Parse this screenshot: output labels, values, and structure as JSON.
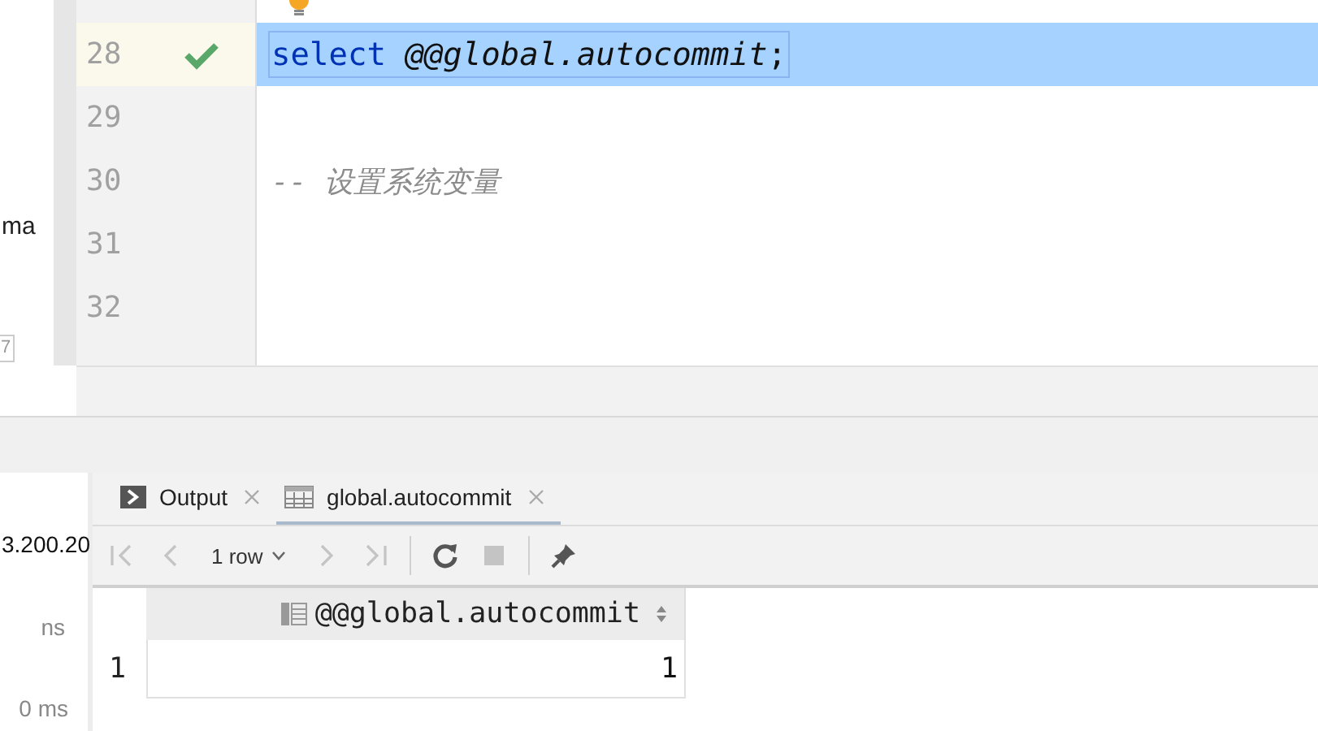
{
  "sidebar": {
    "top_texts": [
      "ma"
    ],
    "badge": "7",
    "bottom_texts": [
      "3.200.20",
      "ns",
      "0 ms"
    ]
  },
  "editor": {
    "lines": [
      {
        "number": "28",
        "ok": true,
        "selected": true,
        "tokens": [
          {
            "kind": "keyword",
            "text": "select"
          },
          {
            "kind": "variable",
            "text": "@@global.autocommit"
          },
          {
            "kind": "plain",
            "text": ";"
          }
        ]
      },
      {
        "number": "29",
        "ok": false,
        "selected": false
      },
      {
        "number": "30",
        "ok": false,
        "selected": false,
        "tokens": [
          {
            "kind": "comment",
            "text": "-- 设置系统变量"
          }
        ]
      },
      {
        "number": "31",
        "ok": false,
        "selected": false
      },
      {
        "number": "32",
        "ok": false,
        "selected": false
      }
    ]
  },
  "results": {
    "tabs": [
      {
        "label": "Output",
        "kind": "console",
        "selected": false
      },
      {
        "label": "global.autocommit",
        "kind": "table",
        "selected": true
      }
    ],
    "toolbar": [
      {
        "kind": "first",
        "disabled": true
      },
      {
        "kind": "prev",
        "disabled": true
      },
      {
        "kind": "rows",
        "label": "1 row",
        "disabled": false
      },
      {
        "kind": "next",
        "disabled": true
      },
      {
        "kind": "last",
        "disabled": true
      },
      {
        "kind": "sep"
      },
      {
        "kind": "refresh",
        "disabled": false
      },
      {
        "kind": "stop",
        "disabled": true
      },
      {
        "kind": "sep"
      },
      {
        "kind": "pin",
        "disabled": false
      }
    ],
    "table": {
      "columns": [
        "@@global.autocommit"
      ],
      "rows": [
        {
          "number": "1",
          "cells": [
            "1"
          ]
        }
      ]
    }
  }
}
